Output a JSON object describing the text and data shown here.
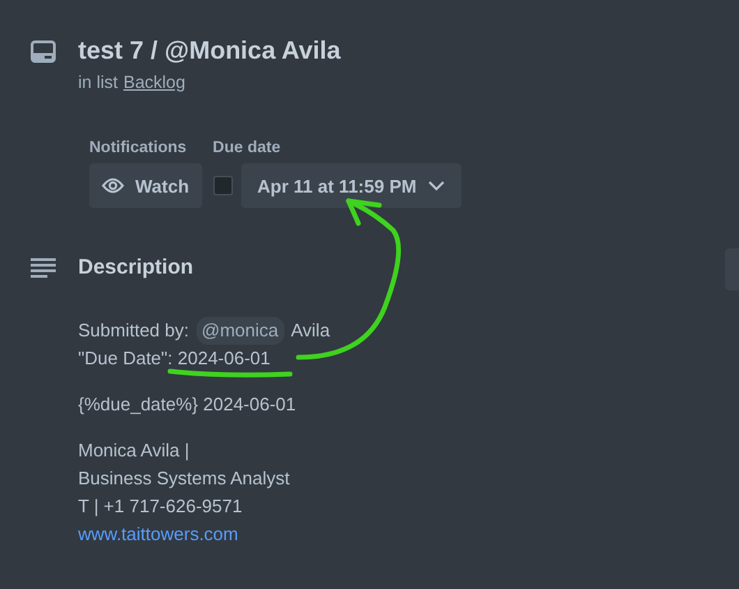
{
  "card": {
    "title": "test 7 / @Monica Avila",
    "list_prefix": "in list",
    "list_name": "Backlog"
  },
  "notifications": {
    "label": "Notifications",
    "button": "Watch"
  },
  "due_date": {
    "label": "Due date",
    "checked": false,
    "value": "Apr 11 at 11:59 PM"
  },
  "description": {
    "heading": "Description",
    "paragraphs": [
      {
        "lines": [
          {
            "parts": [
              {
                "kind": "text",
                "text": "Submitted by:"
              },
              {
                "kind": "mention",
                "text": "@monica"
              },
              {
                "kind": "text",
                "text": "Avila"
              }
            ]
          },
          {
            "parts": [
              {
                "kind": "text",
                "text": "\"Due Date\": 2024-06-01"
              }
            ]
          }
        ]
      },
      {
        "lines": [
          {
            "parts": [
              {
                "kind": "text",
                "text": "{%due_date%} 2024-06-01"
              }
            ]
          }
        ]
      },
      {
        "lines": [
          {
            "parts": [
              {
                "kind": "text",
                "text": "Monica Avila |"
              }
            ]
          },
          {
            "parts": [
              {
                "kind": "text",
                "text": "Business Systems Analyst"
              }
            ]
          },
          {
            "parts": [
              {
                "kind": "text",
                "text": "T | +1 717-626-9571"
              }
            ]
          },
          {
            "parts": [
              {
                "kind": "link",
                "text": "www.taittowers.com"
              }
            ]
          }
        ]
      }
    ]
  }
}
